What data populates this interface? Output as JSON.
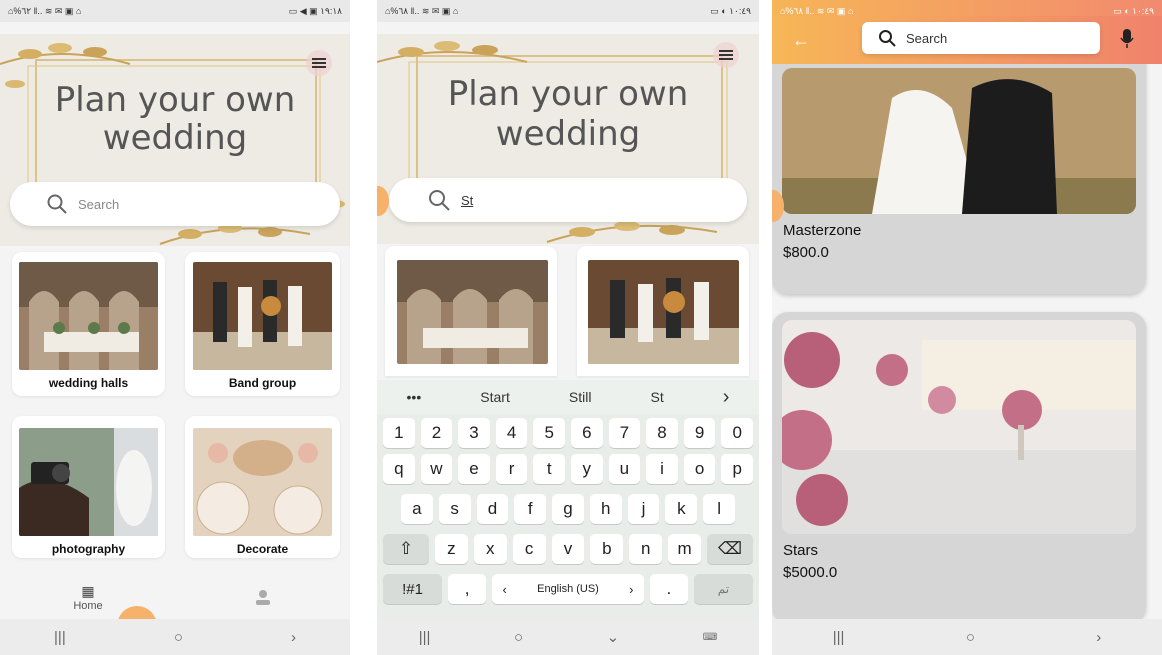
{
  "screen1": {
    "status_left": "⌂%٦٢ ‖.. ≋ ✉ ▣ ⌂",
    "status_right": "▭ ◀ ▣ ١٩:١٨",
    "hero_title_line1": "Plan your own",
    "hero_title_line2": "wedding",
    "search_placeholder": "Search",
    "categories": [
      {
        "label": "wedding halls"
      },
      {
        "label": "Band group"
      },
      {
        "label": "photography"
      },
      {
        "label": "Decorate"
      }
    ],
    "nav_home_label": "Home"
  },
  "screen2": {
    "status_left": "⌂%٦٨ ‖.. ≋ ✉ ▣ ⌂",
    "status_right": "▭ ◐ ١٠:٤٩",
    "hero_title_line1": "Plan your own",
    "hero_title_line2": "wedding",
    "search_value": "St",
    "suggestions": [
      "•••",
      "Start",
      "Still",
      "St",
      "›"
    ],
    "keyboard": {
      "row1": [
        "1",
        "2",
        "3",
        "4",
        "5",
        "6",
        "7",
        "8",
        "9",
        "0"
      ],
      "row2": [
        "q",
        "w",
        "e",
        "r",
        "t",
        "y",
        "u",
        "i",
        "o",
        "p"
      ],
      "row3": [
        "a",
        "s",
        "d",
        "f",
        "g",
        "h",
        "j",
        "k",
        "l"
      ],
      "row4": [
        "⇧",
        "z",
        "x",
        "c",
        "v",
        "b",
        "n",
        "m",
        "⌫"
      ],
      "row5": [
        "!#1",
        ",",
        "‹",
        "English (US)",
        "›",
        ".",
        "تم"
      ]
    }
  },
  "screen3": {
    "status_left": "⌂%٦٨ ‖.. ≋ ✉ ▣ ⌂",
    "status_right": "▭ ◐ ١٠:٤٩",
    "search_placeholder": "Search",
    "items": [
      {
        "name": "Masterzone",
        "price": "$800.0"
      },
      {
        "name": "Stars",
        "price": "$5000.0"
      }
    ]
  },
  "system_nav": {
    "recents": "|||",
    "home": "○",
    "back": "›"
  },
  "colors": {
    "accent_orange": "#f6b557",
    "accent_coral": "#f0826c",
    "background": "#f4f4f4"
  }
}
